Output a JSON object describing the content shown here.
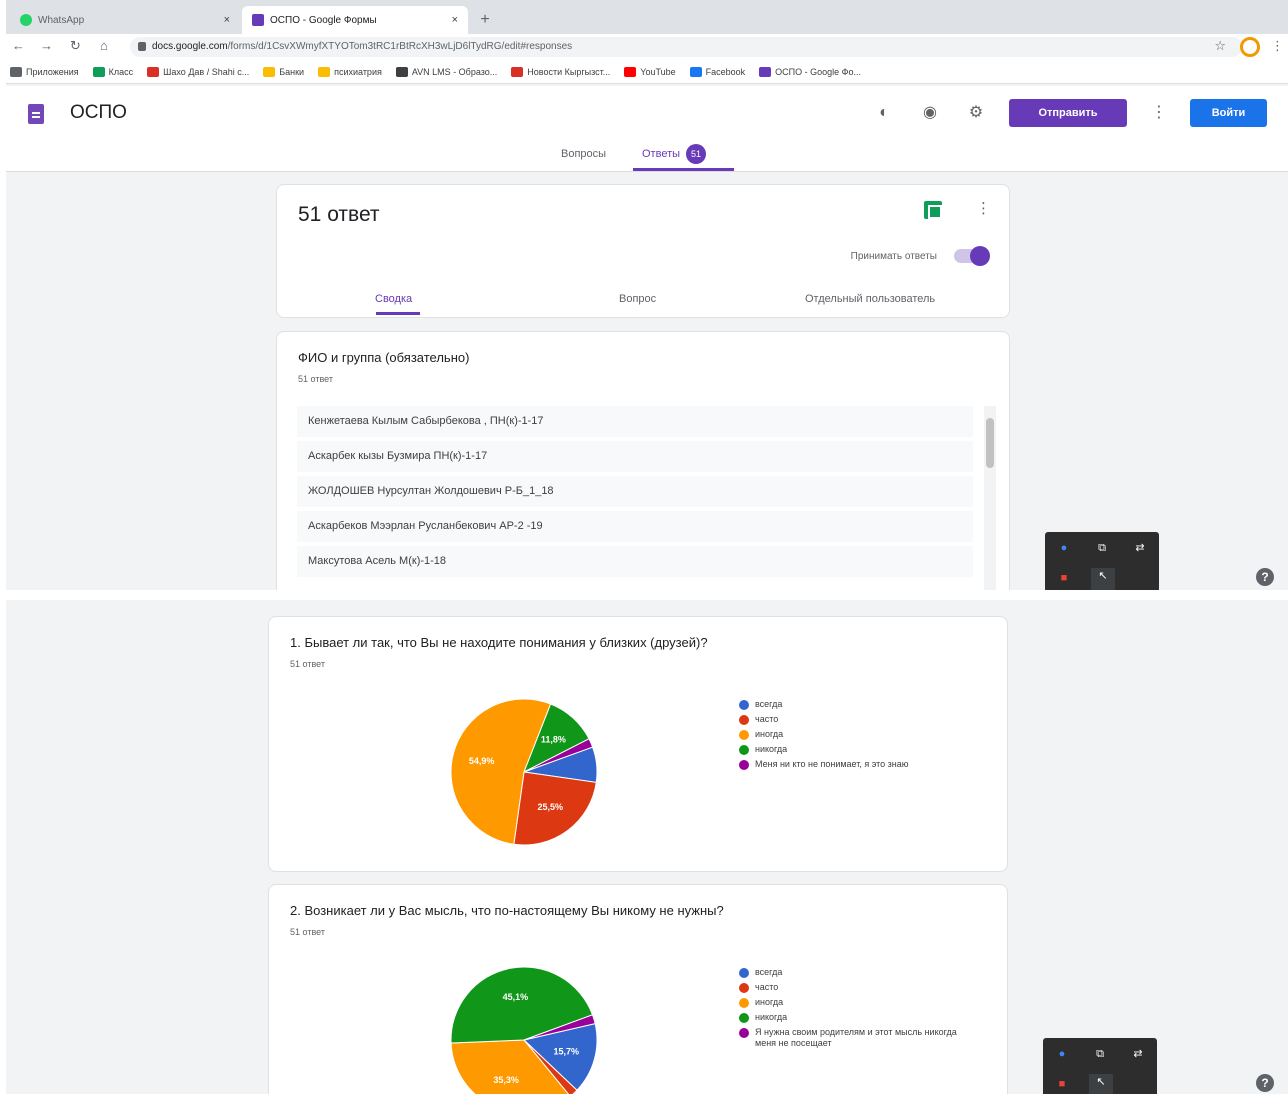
{
  "browser": {
    "tabs": [
      {
        "label": "WhatsApp",
        "favicon_color": "#25d366",
        "close": "×"
      },
      {
        "label": "ОСПО - Google Формы",
        "favicon_color": "#673ab7",
        "close": "×"
      }
    ],
    "new_tab": "+",
    "url_host": "docs.google.com",
    "url_path": "/forms/d/1CsvXWmyfXTYOTom3tRC1rBtRcXH3wLjD6lTydRG/edit#responses",
    "bookmarks": [
      {
        "label": "Приложения",
        "color": "#5f6368"
      },
      {
        "label": "Класс",
        "color": "#0f9d58"
      },
      {
        "label": "Шахо Дав / Shahi с...",
        "color": "#d93025"
      },
      {
        "label": "Банки",
        "color": "#fbbc04"
      },
      {
        "label": "психиатрия",
        "color": "#fbbc04"
      },
      {
        "label": "AVN LMS - Образо...",
        "color": "#3c4043"
      },
      {
        "label": "Новости Кыргызст...",
        "color": "#d93025"
      },
      {
        "label": "YouTube",
        "color": "#ff0000"
      },
      {
        "label": "Facebook",
        "color": "#1877f2"
      },
      {
        "label": "ОСПО - Google Фо...",
        "color": "#673ab7"
      }
    ]
  },
  "app": {
    "title": "ОСПО",
    "send_label": "Отправить",
    "login_label": "Войти",
    "tabs": {
      "questions": "Вопросы",
      "responses": "Ответы",
      "responses_count": "51"
    }
  },
  "summary": {
    "title": "51 ответ",
    "accept_label": "Принимать ответы",
    "tabs": {
      "summary": "Сводка",
      "question": "Вопрос",
      "individual": "Отдельный пользователь"
    }
  },
  "q_fio": {
    "title": "ФИО и группа (обязательно)",
    "count": "51 ответ",
    "responses": [
      "Кенжетаева Кылым Сабырбекова , ПН(к)-1-17",
      "Аскарбек кызы Бузмира ПН(к)-1-17",
      "ЖОЛДОШЕВ Нурсултан Жолдошевич Р-Б_1_18",
      "Аскарбеков Мээрлан Русланбекович АР-2 -19",
      "Максутова Асель М(к)-1-18"
    ]
  },
  "q1": {
    "title": "1. Бывает ли так, что Вы не находите понимания у близких (друзей)?",
    "count": "51 ответ",
    "chart_data": {
      "type": "pie",
      "categories": [
        "всегда",
        "часто",
        "иногда",
        "никогда",
        "Меня ни кто не понимает, я это знаю"
      ],
      "values": [
        8.0,
        25.5,
        54.9,
        11.8,
        2.0
      ],
      "colors": [
        "#3366cc",
        "#dc3912",
        "#ff9900",
        "#109618",
        "#990099"
      ],
      "slice_labels": [
        "",
        "25,5%",
        "54,9%",
        "11,8%",
        ""
      ],
      "legend_position": "right"
    }
  },
  "q2": {
    "title": "2. Возникает ли у Вас мысль, что по-настоящему Вы никому не нужны?",
    "count": "51 ответ",
    "chart_data": {
      "type": "pie",
      "categories": [
        "всегда",
        "часто",
        "иногда",
        "никогда",
        "Я нужна своим родителям и этот мысль никогда меня не посещает"
      ],
      "values": [
        15.7,
        2.0,
        35.3,
        45.1,
        2.0
      ],
      "colors": [
        "#3366cc",
        "#dc3912",
        "#ff9900",
        "#109618",
        "#990099"
      ],
      "slice_labels": [
        "15,7%",
        "",
        "35,3%",
        "45,1%",
        ""
      ],
      "legend_position": "right"
    }
  },
  "icons": {
    "palette": "palette-icon",
    "preview": "eye-icon",
    "settings": "gear-icon",
    "help": "?"
  }
}
